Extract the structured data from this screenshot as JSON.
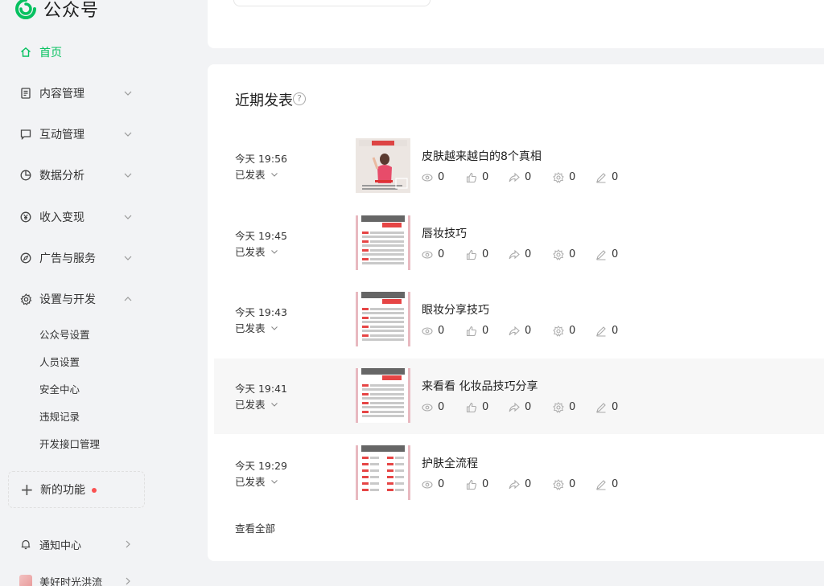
{
  "app": {
    "title": "公众号"
  },
  "sidebar": {
    "home": "首页",
    "items": [
      {
        "label": "内容管理",
        "icon": "document-icon"
      },
      {
        "label": "互动管理",
        "icon": "chat-icon"
      },
      {
        "label": "数据分析",
        "icon": "pie-chart-icon"
      },
      {
        "label": "收入变现",
        "icon": "yen-icon"
      },
      {
        "label": "广告与服务",
        "icon": "compass-icon"
      },
      {
        "label": "设置与开发",
        "icon": "gear-icon"
      }
    ],
    "settings_sub": [
      "公众号设置",
      "人员设置",
      "安全中心",
      "违规记录",
      "开发接口管理"
    ],
    "new_feature": "新的功能",
    "notifications": "通知中心",
    "account": "美好时光洪流"
  },
  "recent": {
    "title": "近期发表",
    "view_all": "查看全部",
    "rows": [
      {
        "time": "今天 19:56",
        "status": "已发表",
        "title": "皮肤越来越白的8个真相",
        "views": "0",
        "likes": "0",
        "shares": "0",
        "recs": "0",
        "comments": "0"
      },
      {
        "time": "今天 19:45",
        "status": "已发表",
        "title": "唇妆技巧",
        "views": "0",
        "likes": "0",
        "shares": "0",
        "recs": "0",
        "comments": "0"
      },
      {
        "time": "今天 19:43",
        "status": "已发表",
        "title": "眼妆分享技巧",
        "views": "0",
        "likes": "0",
        "shares": "0",
        "recs": "0",
        "comments": "0"
      },
      {
        "time": "今天 19:41",
        "status": "已发表",
        "title": "来看看 化妆品技巧分享",
        "views": "0",
        "likes": "0",
        "shares": "0",
        "recs": "0",
        "comments": "0"
      },
      {
        "time": "今天 19:29",
        "status": "已发表",
        "title": "护肤全流程",
        "views": "0",
        "likes": "0",
        "shares": "0",
        "recs": "0",
        "comments": "0"
      }
    ]
  },
  "colors": {
    "accent": "#07c160",
    "dot": "#fa5151",
    "page_bg": "#f2f3f5"
  }
}
